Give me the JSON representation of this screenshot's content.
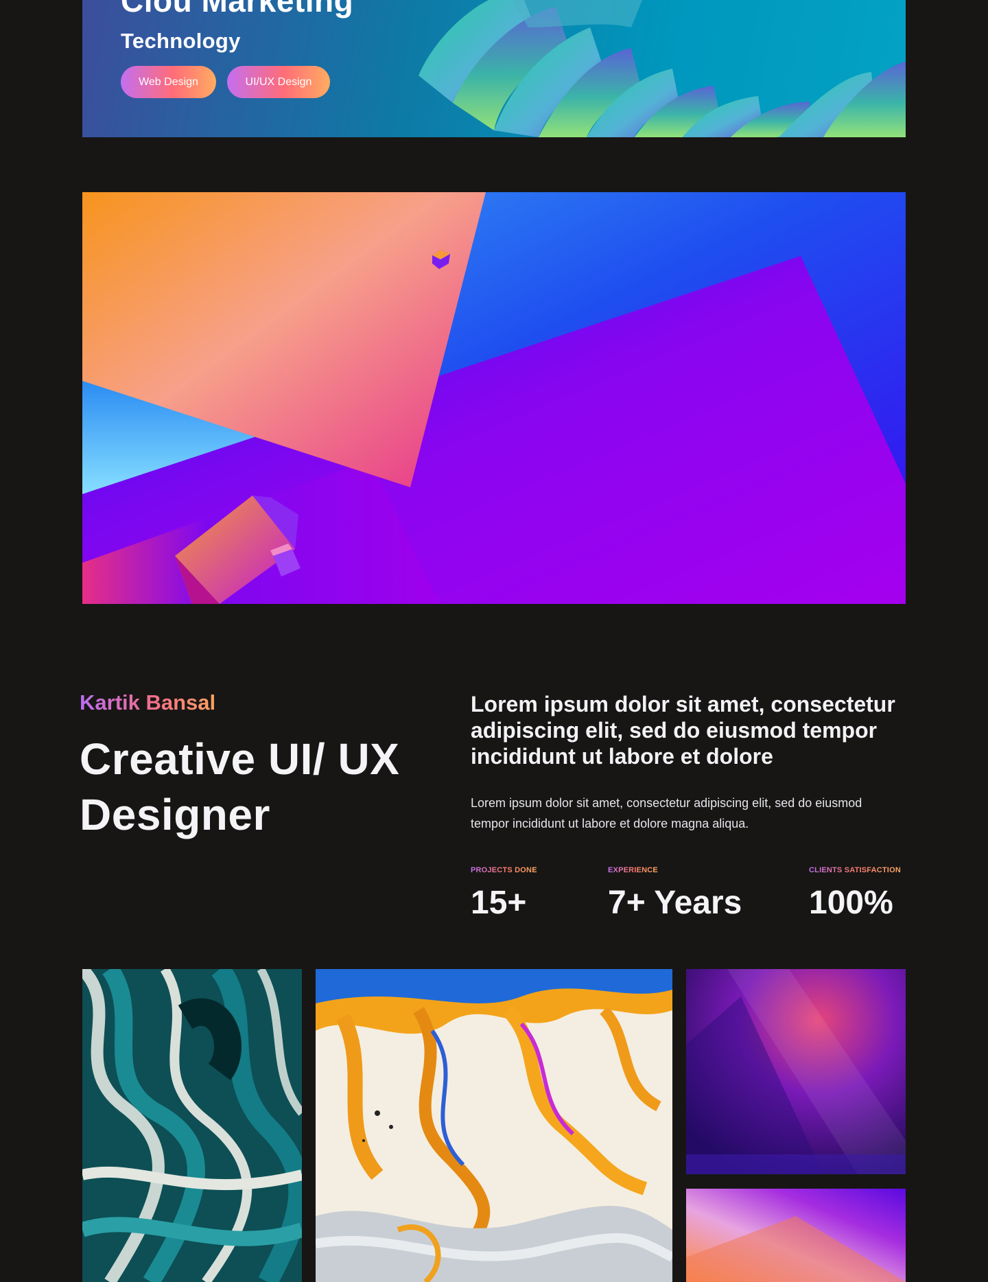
{
  "hero": {
    "title": "Clou Marketing",
    "subtitle": "Technology",
    "tags": [
      "Web Design",
      "UI/UX Design"
    ]
  },
  "about": {
    "name": "Kartik Bansal",
    "role": "Creative UI/ UX Designer",
    "lead": "Lorem ipsum dolor sit amet, consectetur adipiscing elit, sed do eiusmod tempor incididunt ut labore et dolore",
    "body": "Lorem ipsum dolor sit amet, consectetur adipiscing elit, sed do eiusmod tempor incididunt ut labore et dolore magna aliqua.",
    "stats": [
      {
        "label": "PROJECTS DONE",
        "value": "15+"
      },
      {
        "label": "EXPERIENCE",
        "value": "7+ Years"
      },
      {
        "label": "CLIENTS SATISFACTION",
        "value": "100%"
      }
    ]
  },
  "colors": {
    "background": "#171615",
    "accent_gradient": [
      "#c46ef0",
      "#ff6d78",
      "#ffac61"
    ]
  }
}
